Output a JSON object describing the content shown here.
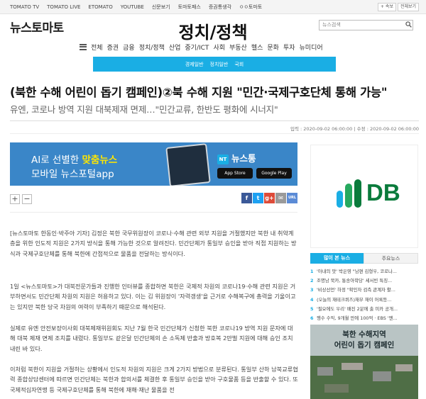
{
  "topbar": {
    "links": [
      "TOMATO TV",
      "TOMATO LIVE",
      "ETOMATO",
      "YOUTUBE",
      "신문보기",
      "토마토패스",
      "증권통생각",
      "ㅇㅇ토마토"
    ],
    "news_btn": "+ 속보",
    "all_btn": "전체보기"
  },
  "header": {
    "logo": "뉴스토마토",
    "section_title": "정치/정책",
    "search_placeholder": "뉴스검색",
    "search_icon": "search-icon"
  },
  "gnb": {
    "items": [
      "전체",
      "증권",
      "금융",
      "정치/정책",
      "산업",
      "중기/ICT",
      "사회",
      "부동산",
      "헬스",
      "문화",
      "투자",
      "뉴미디어"
    ]
  },
  "subnav": {
    "items": [
      "경제일반",
      "정치일반",
      "국회"
    ]
  },
  "article": {
    "headline": "(북한 수해 어린이 돕기 캠페인)②북 수해 지원 \"민간·국제구호단체 통해 가능\"",
    "subheadline": "유엔, 코로나 방역 지원 대북제재 면제…\"민간교류, 한반도 평화에 시너지\"",
    "input_label": "입력 : 2020-09-02 06:00:00",
    "edit_label": "수정 : 2020-09-02 06:00:00",
    "paragraphs": [
      "[뉴스토마토 한동인·박주아 기자] 김정은 북한 국무위원장이 코로나·수해 관련 외부 지원을 거절했지만 북한 내 취약계층을 위한 인도적 지원은 2가지 방식을 통해 가능한 것으로 알려진다. 민간단체가 통일부 승인을 받아 직접 지원하는 방식과 국제구호단체를 통해 북한에 간접적으로 물품을 전달하는 방식이다.",
      "1일 <뉴스토마토>가 대북전문가들과 진행한 인터뷰를 종합하면 북한은 국제적 차원의 코로나19·수해 관련 지원은 거부하면서도 민간단체 차원의 지원은 허용하고 있다. 이는 김 위원장이 '자력갱생'을 근거로 수해복구에 총력을 기울이고는 있지만 북한 당국 차원의 여력이 부족하기 때문으로 해석된다.",
      "실제로 유엔 안전보장이사회 대북제재위원회도 지난 7월 한국 민간단체가 신청한 북한 코로나19 방역 지원 문자에 대해 대북 제재 면제 조치를 내렸다. 통일부도 같은달 민간단체의 손 소독제 반출과 방호복 2만벌 지원에 대해 승인 조치 내린 바 있다.",
      "이처럼 북한이 지원을 거절하는 상황에서 인도적 차원의 지원은 크게 2가지 방법으로 분류된다. 통일부 산하 남북교류협력 종합상담센터에 따르면 민간단체는 북한과 합의서를 체결한 후 통일부 승인을 받아 구호물품 등을 반출할 수 있다. 또 국제적십자연맹 등 국제구호단체를 통해 북한에 재해·재난 물품을 전"
    ]
  },
  "banner": {
    "line1_prefix": "AI로 선별한 ",
    "line1_highlight": "맞춤뉴스",
    "line2": "모바일 뉴스포털app",
    "brand_mark": "NT",
    "brand_name": "뉴스통",
    "app_store": "App Store",
    "google_play": "Google Play"
  },
  "tools": {
    "zoom_in": "+",
    "zoom_out": "−",
    "share": [
      {
        "label": "f",
        "color": "#3b5998",
        "icon": "facebook-icon"
      },
      {
        "label": "t",
        "color": "#1da1f2",
        "icon": "twitter-icon"
      },
      {
        "label": "g+",
        "color": "#dd4b39",
        "icon": "google-plus-icon"
      },
      {
        "label": "✉",
        "color": "#9a9a9a",
        "icon": "mail-icon"
      },
      {
        "label": "URL",
        "color": "#5b8bd6",
        "icon": "url-copy-icon"
      }
    ]
  },
  "sidebar": {
    "ad_brand": "DB",
    "tabs": [
      "많이 본 뉴스",
      "주요뉴스"
    ],
    "news": [
      "'아내의 맛' 박은영 \"남편 김형우, 코로나...",
      "조명남 북카, 통송아학당' 세서빈 특징...",
      "'비상선언' 하정 \"확인자 검측 관계자 활...",
      "(오늘의 재테크퀴즈)재무 재이 어록등...",
      "'필요에도 우리' 배진 2분에 출 미카 공개...",
      "행수 수익, 9개월 만에 100억 · EBS '엔..."
    ],
    "campaign_line1": "북한 수해지역",
    "campaign_line2": "어린이 돕기 캠페인"
  }
}
